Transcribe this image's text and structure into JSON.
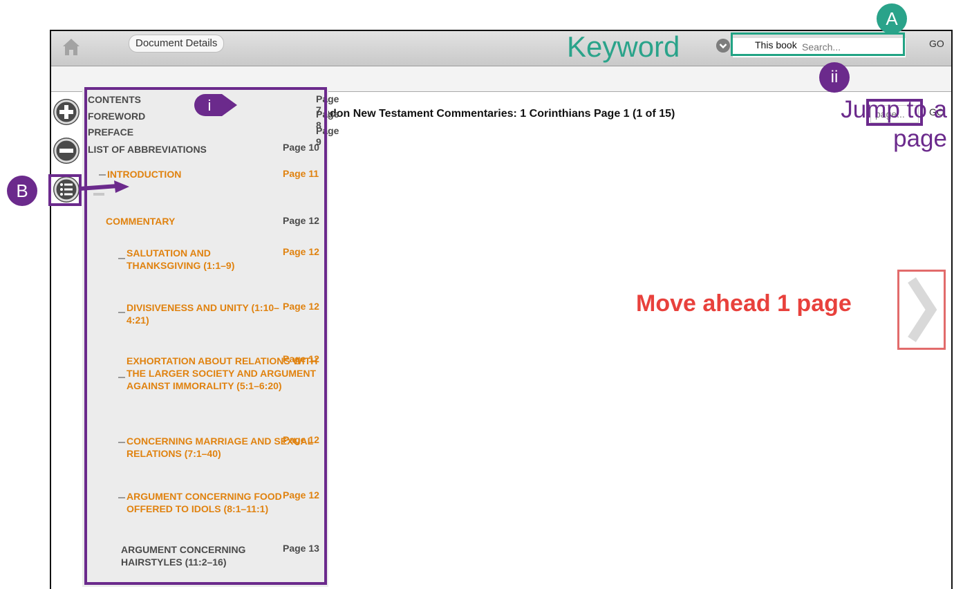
{
  "toolbar": {
    "document_details_label": "Document Details",
    "search_scope": "This book",
    "search_placeholder": "Search...",
    "go_label": "GO"
  },
  "title_bar": {
    "title": "Abingdon New Testament Commentaries: 1 Corinthians Page 1 (1 of 15)",
    "page_placeholder": "page...",
    "go_label": "GO"
  },
  "toc": [
    {
      "label": "CONTENTS",
      "page": "Page 7",
      "active": false
    },
    {
      "label": "FOREWORD",
      "page": "Page 8",
      "active": false
    },
    {
      "label": "PREFACE",
      "page": "Page 9",
      "active": false
    },
    {
      "label": "LIST OF ABBREVIATIONS",
      "page": "Page 10",
      "active": false
    },
    {
      "label": "INTRODUCTION",
      "page": "Page 11",
      "active": true
    },
    {
      "label": "COMMENTARY",
      "page": "Page 12",
      "active": true
    },
    {
      "label": "SALUTATION AND THANKSGIVING (1:1–9)",
      "page": "Page 12",
      "active": true
    },
    {
      "label": "DIVISIVENESS AND UNITY (1:10–4:21)",
      "page": "Page 12",
      "active": true
    },
    {
      "label": "EXHORTATION ABOUT RELATIONS WITH THE LARGER SOCIETY AND ARGUMENT AGAINST IMMORALITY (5:1–6:20)",
      "page": "Page 12",
      "active": true
    },
    {
      "label": "CONCERNING MARRIAGE AND SEXUAL RELATIONS (7:1–40)",
      "page": "Page 12",
      "active": true
    },
    {
      "label": "ARGUMENT CONCERNING FOOD OFFERED TO IDOLS (8:1–11:1)",
      "page": "Page 12",
      "active": true
    },
    {
      "label": "ARGUMENT CONCERNING HAIRSTYLES (11:2–16)",
      "page": "Page 13",
      "active": false
    }
  ],
  "annotations": {
    "keyword": "Keyword",
    "marker_a": "A",
    "marker_b": "B",
    "marker_i": "i",
    "marker_ii": "ii",
    "jump_to_page": "Jump to a page",
    "move_ahead": "Move ahead 1 page"
  },
  "colors": {
    "accent_orange": "#e0820f",
    "annotation_purple": "#6b2a8c",
    "annotation_green": "#2aa38a",
    "annotation_red": "#e8413c"
  }
}
